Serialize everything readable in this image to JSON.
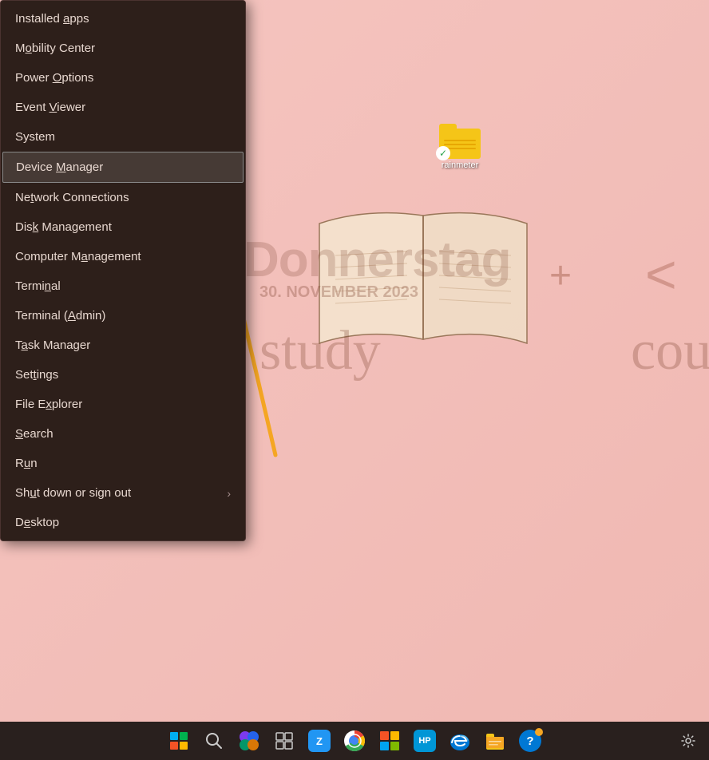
{
  "desktop": {
    "background_color": "#f5c5c0"
  },
  "desktop_icon": {
    "label": "rainmeter",
    "name": "rainmeter-folder"
  },
  "decorative_text": {
    "line1": "Donnerstag",
    "line2": "study",
    "line3": "30. November 2023",
    "line4": "cou"
  },
  "context_menu": {
    "items": [
      {
        "id": "installed-apps",
        "label": "Installed apps",
        "underline": "a",
        "has_arrow": false
      },
      {
        "id": "mobility-center",
        "label": "Mobility Center",
        "underline": "o",
        "has_arrow": false
      },
      {
        "id": "power-options",
        "label": "Power Options",
        "underline": "O",
        "has_arrow": false
      },
      {
        "id": "event-viewer",
        "label": "Event Viewer",
        "underline": "V",
        "has_arrow": false
      },
      {
        "id": "system",
        "label": "System",
        "underline": "",
        "has_arrow": false
      },
      {
        "id": "device-manager",
        "label": "Device Manager",
        "underline": "M",
        "has_arrow": false,
        "highlighted": true
      },
      {
        "id": "network-connections",
        "label": "Network Connections",
        "underline": "t",
        "has_arrow": false
      },
      {
        "id": "disk-management",
        "label": "Disk Management",
        "underline": "k",
        "has_arrow": false
      },
      {
        "id": "computer-management",
        "label": "Computer Management",
        "underline": "a",
        "has_arrow": false
      },
      {
        "id": "terminal",
        "label": "Terminal",
        "underline": "m",
        "has_arrow": false
      },
      {
        "id": "terminal-admin",
        "label": "Terminal (Admin)",
        "underline": "A",
        "has_arrow": false
      },
      {
        "id": "task-manager",
        "label": "Task Manager",
        "underline": "a",
        "has_arrow": false
      },
      {
        "id": "settings",
        "label": "Settings",
        "underline": "t",
        "has_arrow": false
      },
      {
        "id": "file-explorer",
        "label": "File Explorer",
        "underline": "x",
        "has_arrow": false
      },
      {
        "id": "search",
        "label": "Search",
        "underline": "S",
        "has_arrow": false
      },
      {
        "id": "run",
        "label": "Run",
        "underline": "u",
        "has_arrow": false
      },
      {
        "id": "shut-down",
        "label": "Shut down or sign out",
        "underline": "u",
        "has_arrow": true
      },
      {
        "id": "desktop",
        "label": "Desktop",
        "underline": "e",
        "has_arrow": false
      }
    ]
  },
  "taskbar": {
    "icons": [
      {
        "id": "start",
        "type": "windows-logo",
        "label": "Start"
      },
      {
        "id": "search",
        "type": "search",
        "label": "Search"
      },
      {
        "id": "copilot",
        "type": "copilot",
        "label": "Copilot"
      },
      {
        "id": "task-view",
        "type": "task-view",
        "label": "Task View"
      },
      {
        "id": "zoom",
        "type": "zoom",
        "label": "Zoom"
      },
      {
        "id": "chrome",
        "type": "chrome",
        "label": "Chrome"
      },
      {
        "id": "store",
        "type": "store",
        "label": "Microsoft Store"
      },
      {
        "id": "hp",
        "type": "hp",
        "label": "HP Support"
      },
      {
        "id": "edge",
        "type": "edge",
        "label": "Microsoft Edge"
      },
      {
        "id": "explorer",
        "type": "explorer",
        "label": "File Explorer"
      },
      {
        "id": "help",
        "type": "help",
        "label": "Get Help"
      }
    ]
  }
}
